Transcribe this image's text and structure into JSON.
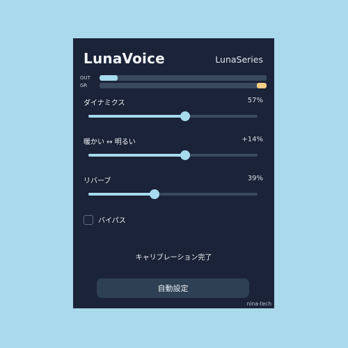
{
  "header": {
    "title": "LunaVoice",
    "series": "LunaSeries"
  },
  "meters": {
    "out": {
      "label": "OUT",
      "level": 0.11
    },
    "gr": {
      "label": "GR",
      "level": 0.06
    }
  },
  "params": [
    {
      "label": "ダイナミクス",
      "value_text": "57%",
      "value": 0.57
    },
    {
      "label": "暖かい ↔ 明るい",
      "value_text": "+14%",
      "value": 0.57
    },
    {
      "label": "リバーブ",
      "value_text": "39%",
      "value": 0.39
    }
  ],
  "bypass": {
    "label": "バイパス",
    "checked": false
  },
  "status": "キャリブレーション完了",
  "auto_button": "自動設定",
  "brand": "nina-tech",
  "colors": {
    "background": "#a9d9ea",
    "panel": "#1b2338",
    "accent": "#a7dbee",
    "gr_meter": "#f5cd83",
    "track": "#3a4b5e",
    "button": "#2e4053"
  }
}
